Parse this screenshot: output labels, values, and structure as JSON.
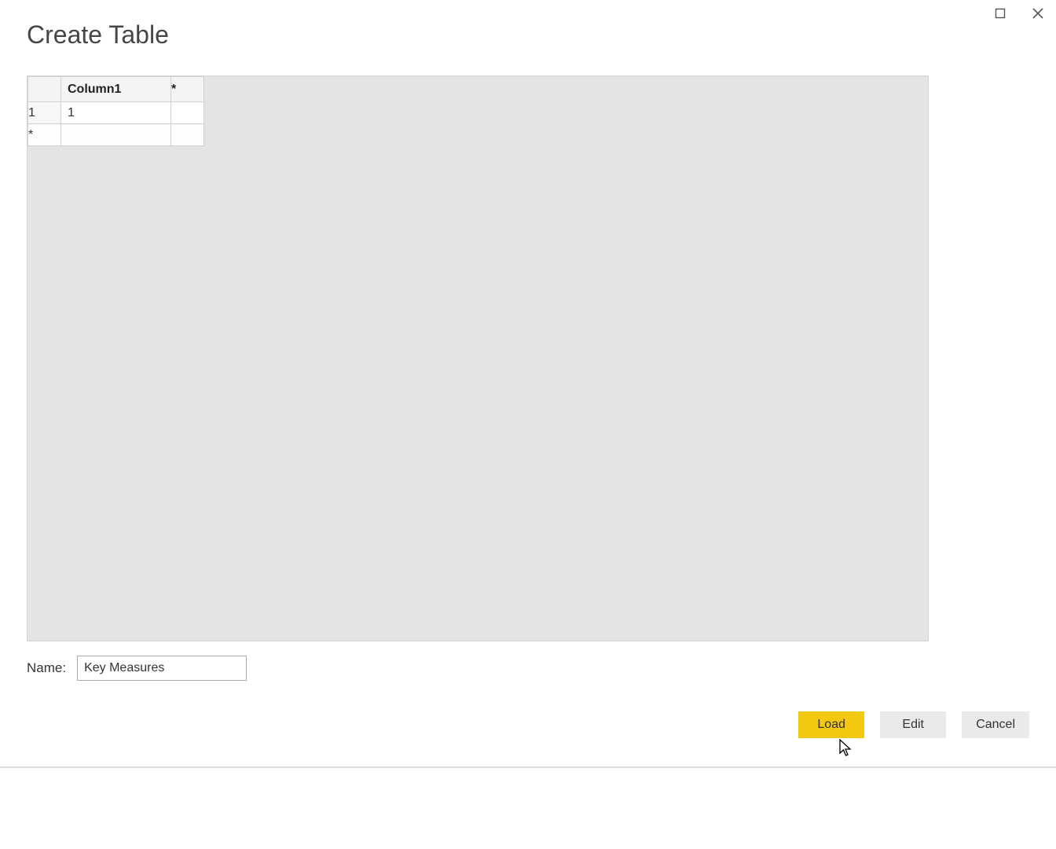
{
  "dialog": {
    "title": "Create Table"
  },
  "grid": {
    "columns": [
      "Column1"
    ],
    "add_column_marker": "*",
    "rows": [
      {
        "num": "1",
        "cells": [
          "1"
        ]
      }
    ],
    "new_row_marker": "*"
  },
  "name_field": {
    "label": "Name:",
    "value": "Key Measures"
  },
  "buttons": {
    "load": "Load",
    "edit": "Edit",
    "cancel": "Cancel"
  }
}
